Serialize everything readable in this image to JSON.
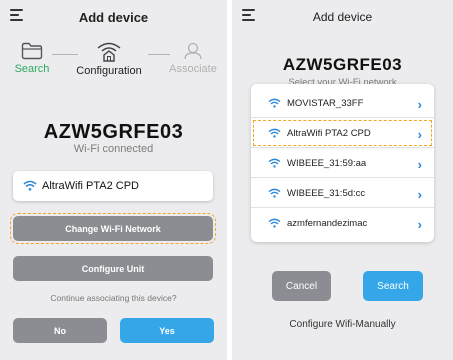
{
  "left": {
    "header_title": "Add device",
    "steps": [
      {
        "label": "Search",
        "color": "#2eaa5f"
      },
      {
        "label": "Configuration",
        "color": "#222222"
      },
      {
        "label": "Associate",
        "color": "#b0b0b0"
      }
    ],
    "device_name": "AZW5GRFE03",
    "status": "Wi-Fi connected",
    "connected_network": "AltraWifi PTA2 CPD",
    "change_wifi_label": "Change Wi-Fi Network",
    "configure_unit_label": "Configure Unit",
    "question": "Continue associating this device?",
    "no_label": "No",
    "yes_label": "Yes"
  },
  "right": {
    "header_title": "Add device",
    "device_name": "AZW5GRFE03",
    "subtitle": "Select your Wi-Fi network",
    "networks": [
      "MOVISTAR_33FF",
      "AltraWifi PTA2 CPD",
      "WIBEEE_31:59:aa",
      "WIBEEE_31:5d:cc",
      "azmfernandezimac"
    ],
    "cancel_label": "Cancel",
    "search_label": "Search",
    "manual_label": "Configure Wifi-Manually"
  },
  "colors": {
    "accent_blue": "#35a6e8",
    "gray_button": "#8b8d92",
    "highlight": "#f5a623",
    "success_green": "#2eaa5f"
  },
  "icons": [
    "menu-icon",
    "folder-icon",
    "wifi-router-icon",
    "user-icon",
    "wifi-icon",
    "chevron-right-icon"
  ]
}
